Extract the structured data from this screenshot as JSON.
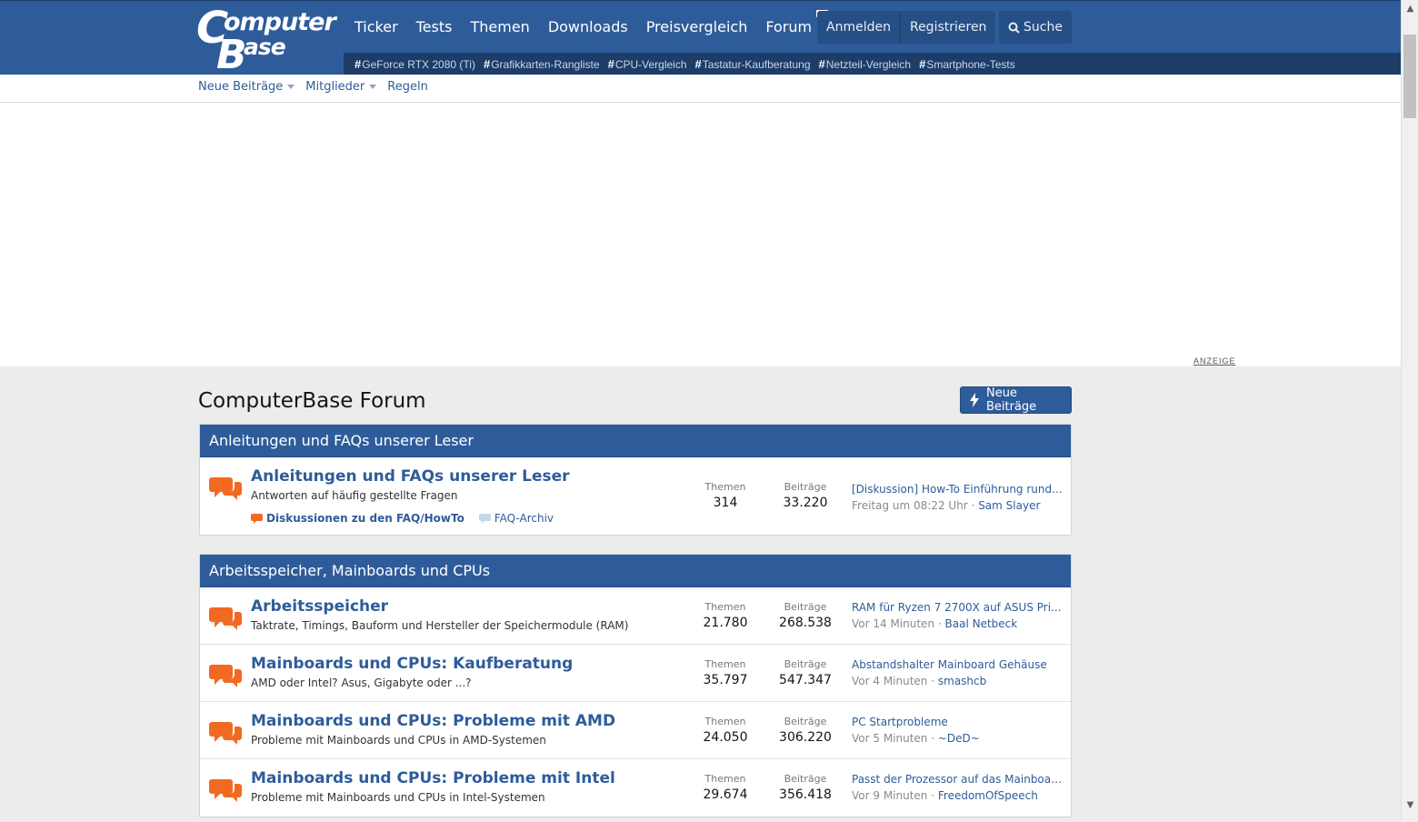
{
  "header": {
    "logo_text": [
      "C",
      "omputer",
      "B",
      "ase"
    ],
    "nav": [
      "Ticker",
      "Tests",
      "Themen",
      "Downloads",
      "Preisvergleich",
      "Forum"
    ],
    "login": "Anmelden",
    "register": "Registrieren",
    "search": "Suche",
    "tags": [
      "GeForce RTX 2080 (Ti)",
      "Grafikkarten-Rangliste",
      "CPU-Vergleich",
      "Tastatur-Kaufberatung",
      "Netzteil-Vergleich",
      "Smartphone-Tests"
    ]
  },
  "subnav": {
    "items": [
      "Neue Beiträge",
      "Mitglieder",
      "Regeln"
    ]
  },
  "ad_label": "ANZEIGE",
  "page": {
    "title": "ComputerBase Forum",
    "new_posts_button": "Neue Beiträge"
  },
  "categories": [
    {
      "title": "Anleitungen und FAQs unserer Leser",
      "nodes": [
        {
          "title": "Anleitungen und FAQs unserer Leser",
          "desc": "Antworten auf häufig gestellte Fragen",
          "subforums": [
            "Diskussionen zu den FAQ/HowTo",
            "FAQ-Archiv"
          ],
          "threads_label": "Themen",
          "threads": "314",
          "posts_label": "Beiträge",
          "posts": "33.220",
          "last_title": "[Diskussion] How-To Einführung rund...",
          "last_time": "Freitag um 08:22 Uhr",
          "last_user": "Sam Slayer"
        }
      ]
    },
    {
      "title": "Arbeitsspeicher, Mainboards und CPUs",
      "nodes": [
        {
          "title": "Arbeitsspeicher",
          "desc": "Taktrate, Timings, Bauform und Hersteller der Speichermodule (RAM)",
          "threads_label": "Themen",
          "threads": "21.780",
          "posts_label": "Beiträge",
          "posts": "268.538",
          "last_title": "RAM für Ryzen 7 2700X auf ASUS Pri...",
          "last_time": "Vor 14 Minuten",
          "last_user": "Baal Netbeck"
        },
        {
          "title": "Mainboards und CPUs: Kaufberatung",
          "desc": "AMD oder Intel? Asus, Gigabyte oder ...?",
          "threads_label": "Themen",
          "threads": "35.797",
          "posts_label": "Beiträge",
          "posts": "547.347",
          "last_title": "Abstandshalter Mainboard Gehäuse",
          "last_time": "Vor 4 Minuten",
          "last_user": "smashcb"
        },
        {
          "title": "Mainboards und CPUs: Probleme mit AMD",
          "desc": "Probleme mit Mainboards und CPUs in AMD-Systemen",
          "threads_label": "Themen",
          "threads": "24.050",
          "posts_label": "Beiträge",
          "posts": "306.220",
          "last_title": "PC Startprobleme",
          "last_time": "Vor 5 Minuten",
          "last_user": "~DeD~"
        },
        {
          "title": "Mainboards und CPUs: Probleme mit Intel",
          "desc": "Probleme mit Mainboards und CPUs in Intel-Systemen",
          "threads_label": "Themen",
          "threads": "29.674",
          "posts_label": "Beiträge",
          "posts": "356.418",
          "last_title": "Passt der Prozessor auf das Mainboard?",
          "last_time": "Vor 9 Minuten",
          "last_user": "FreedomOfSpeech"
        }
      ]
    }
  ],
  "colors": {
    "brand_blue": "#2e5c9a",
    "dark_blue": "#1d3d68",
    "forum_icon_orange": "#f26a21"
  },
  "icons": {
    "forum_node": "chat-bubbles-icon",
    "search": "magnifier-icon",
    "new_posts": "lightning-icon"
  }
}
